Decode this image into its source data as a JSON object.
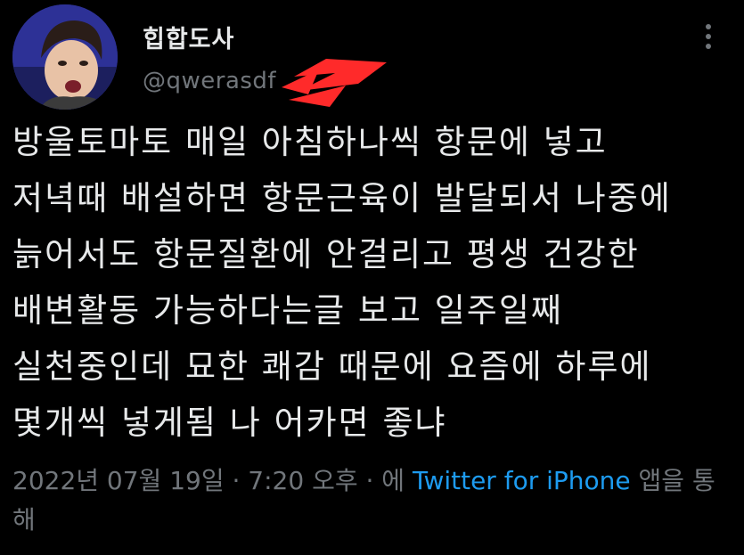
{
  "author": {
    "display_name": "힙합도사",
    "handle": "@qwerasdf"
  },
  "tweet": {
    "lines": [
      "방울토마토 매일 아침하나씩 항문에 넣고",
      "저녁때 배설하면 항문근육이 발달되서 나중에",
      "늙어서도 항문질환에 안걸리고 평생 건강한",
      "배변활동 가능하다는글 보고 일주일째",
      "실천중인데 묘한 쾌감 때문에 요즘에 하루에",
      "몇개씩 넣게됨 나 어카면 좋냐"
    ]
  },
  "meta": {
    "timestamp": "2022년 07월 19일 · 7:20 오후 · 에 ",
    "source": "Twitter for iPhone",
    "suffix": " 앱을 통해"
  },
  "icons": {
    "more": "more-vertical-icon"
  },
  "colors": {
    "background": "#000000",
    "text": "#e7e9ea",
    "muted": "#71767b",
    "link": "#1d9bf0",
    "redaction": "#ff2a2a"
  }
}
